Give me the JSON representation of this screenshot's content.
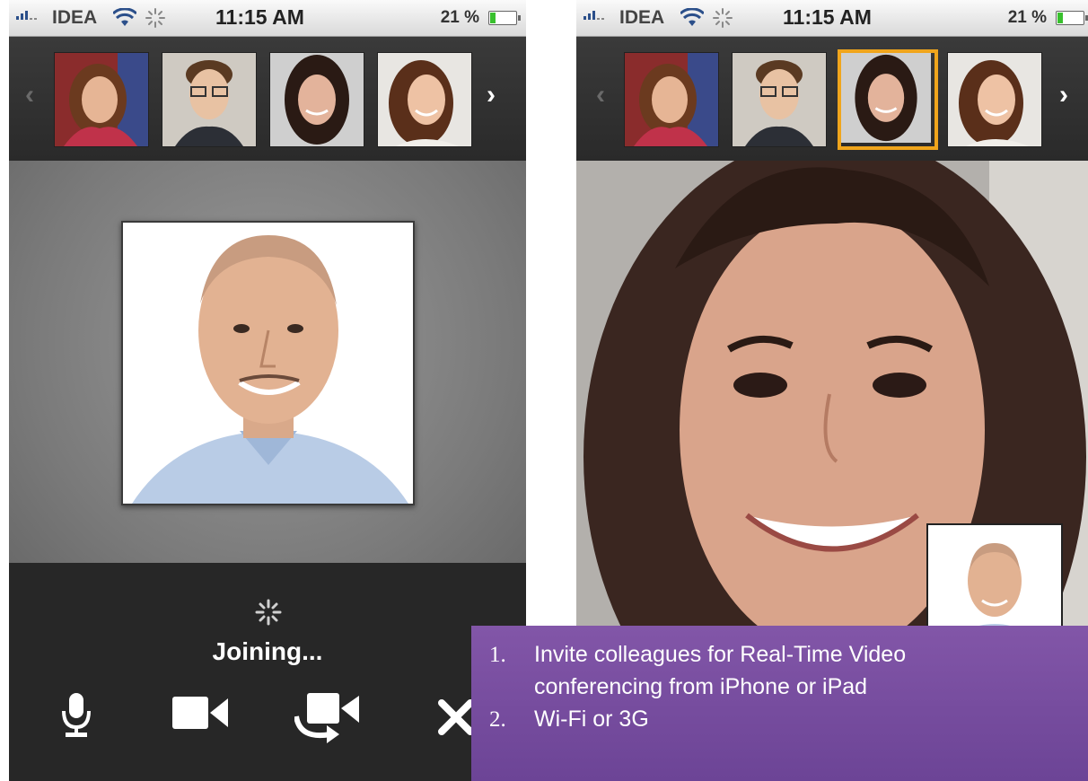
{
  "status_bar": {
    "carrier": "IDEA",
    "time": "11:15 AM",
    "battery": "21 %"
  },
  "participants": [
    {
      "name": "woman-scarf"
    },
    {
      "name": "man-glasses"
    },
    {
      "name": "woman-dark-hair"
    },
    {
      "name": "woman-smiling"
    }
  ],
  "left_screen": {
    "status_text": "Joining...",
    "controls": [
      "mic-icon",
      "video-camera-icon",
      "switch-camera-icon",
      "close-icon"
    ]
  },
  "right_screen": {
    "selected_participant_index": 2
  },
  "caption": {
    "items": [
      {
        "number": "1.",
        "text_line1": "Invite colleagues for Real-Time Video",
        "text_line2": "conferencing from iPhone or iPad"
      },
      {
        "number": "2.",
        "text_line1": "Wi-Fi or 3G"
      }
    ]
  },
  "colors": {
    "selected_border": "#f0a51c",
    "caption_bg": "#7a50a2"
  }
}
